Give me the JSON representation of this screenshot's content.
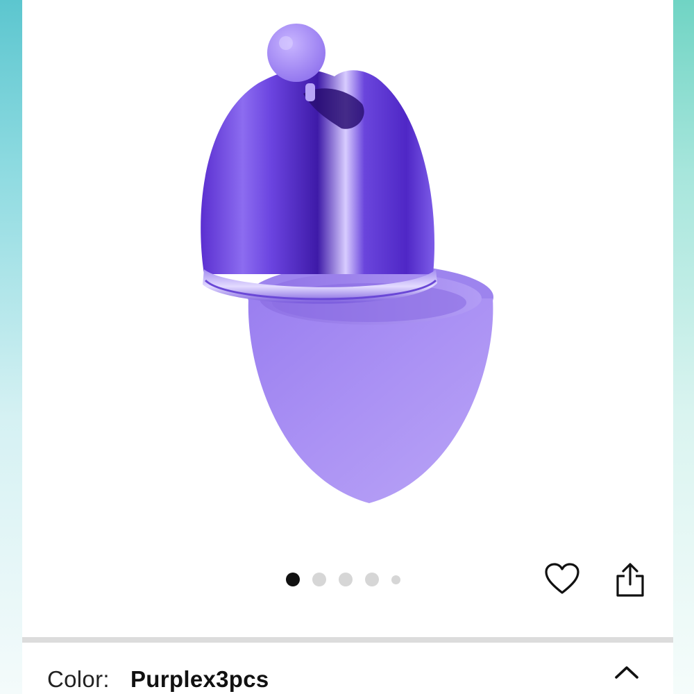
{
  "gallery": {
    "image_alt": "Purple metallic egg-shaped sponge holder with silicone base",
    "dot_count": 5,
    "active_index": 0
  },
  "actions": {
    "wishlist_icon": "heart-outline-icon",
    "share_icon": "share-icon"
  },
  "variation": {
    "label": "Color:",
    "value": "Purplex3pcs",
    "toggle_icon": "chevron-up-icon"
  },
  "colors": {
    "metallic_purple": "#6a3fd6",
    "silicone_purple": "#a58af2",
    "active_dot": "#111111",
    "inactive_dot": "#d6d6d6"
  }
}
